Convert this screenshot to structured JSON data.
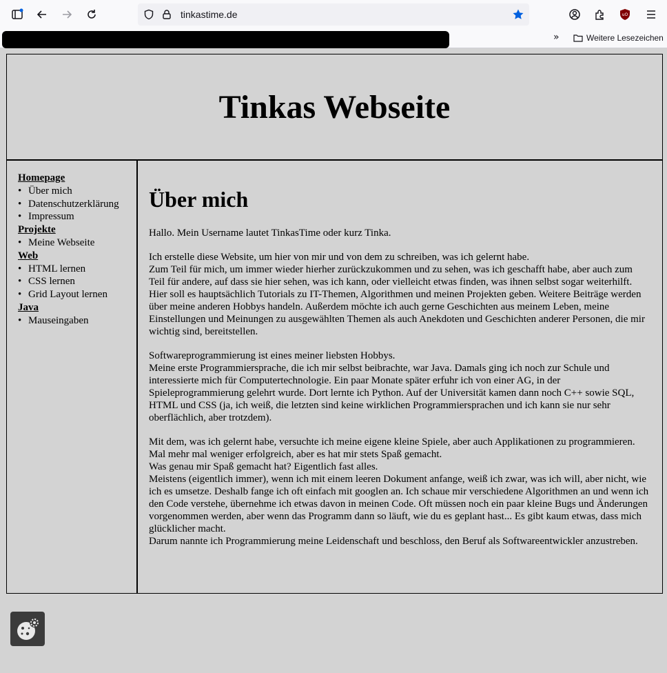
{
  "browser": {
    "url": "tinkastime.de",
    "bookmarks_folder_label": "Weitere Lesezeichen",
    "accent_color": "#0060df"
  },
  "site": {
    "title": "Tinkas Webseite"
  },
  "sidebar": {
    "groups": [
      {
        "title": "Homepage",
        "items": [
          "Über mich",
          "Datenschutzerklärung",
          "Impressum"
        ]
      },
      {
        "title": "Projekte",
        "items": [
          "Meine Webseite"
        ]
      },
      {
        "title": "Web",
        "items": [
          "HTML lernen",
          "CSS lernen",
          "Grid Layout lernen"
        ]
      },
      {
        "title": "Java",
        "items": [
          "Mauseingaben"
        ]
      }
    ]
  },
  "main": {
    "heading": "Über mich",
    "paragraphs": [
      [
        "Hallo. Mein Username lautet TinkasTime oder kurz Tinka."
      ],
      [
        "Ich erstelle diese Website, um hier von mir und von dem zu schreiben, was ich gelernt habe.",
        "Zum Teil für mich, um immer wieder hierher zurückzukommen und zu sehen, was ich geschafft habe, aber auch zum Teil für andere, auf dass sie hier sehen, was ich kann, oder vielleicht etwas finden, was ihnen selbst sogar weiterhilft.",
        "Hier soll es hauptsächlich Tutorials zu IT-Themen, Algorithmen und meinen Projekten geben. Weitere Beiträge werden über meine anderen Hobbys handeln. Außerdem möchte ich auch gerne Geschichten aus meinem Leben, meine Einstellungen und Meinungen zu ausgewählten Themen als auch Anekdoten und Geschichten anderer Personen, die mir wichtig sind, bereitstellen."
      ],
      [
        "Softwareprogrammierung ist eines meiner liebsten Hobbys.",
        "Meine erste Programmiersprache, die ich mir selbst beibrachte, war Java. Damals ging ich noch zur Schule und interessierte mich für Computertechnologie. Ein paar Monate später erfuhr ich von einer AG, in der Spieleprogrammierung gelehrt wurde. Dort lernte ich Python. Auf der Universität kamen dann noch C++ sowie SQL, HTML und CSS (ja, ich weiß, die letzten sind keine wirklichen Programmiersprachen und ich kann sie nur sehr oberflächlich, aber trotzdem)."
      ],
      [
        "Mit dem, was ich gelernt habe, versuchte ich meine eigene kleine Spiele, aber auch Applikationen zu programmieren. Mal mehr mal weniger erfolgreich, aber es hat mir stets Spaß gemacht.",
        "Was genau mir Spaß gemacht hat? Eigentlich fast alles.",
        "Meistens (eigentlich immer), wenn ich mit einem leeren Dokument anfange, weiß ich zwar, was ich will, aber nicht, wie ich es umsetze. Deshalb fange ich oft einfach mit googlen an. Ich schaue mir verschiedene Algorithmen an und wenn ich den Code verstehe, übernehme ich etwas davon in meinen Code. Oft müssen noch ein paar kleine Bugs und Änderungen vorgenommen werden, aber wenn das Programm dann so läuft, wie du es geplant hast... Es gibt kaum etwas, dass mich glücklicher macht.",
        "Darum nannte ich Programmierung meine Leidenschaft und beschloss, den Beruf als Softwareentwickler anzustreben."
      ]
    ]
  }
}
